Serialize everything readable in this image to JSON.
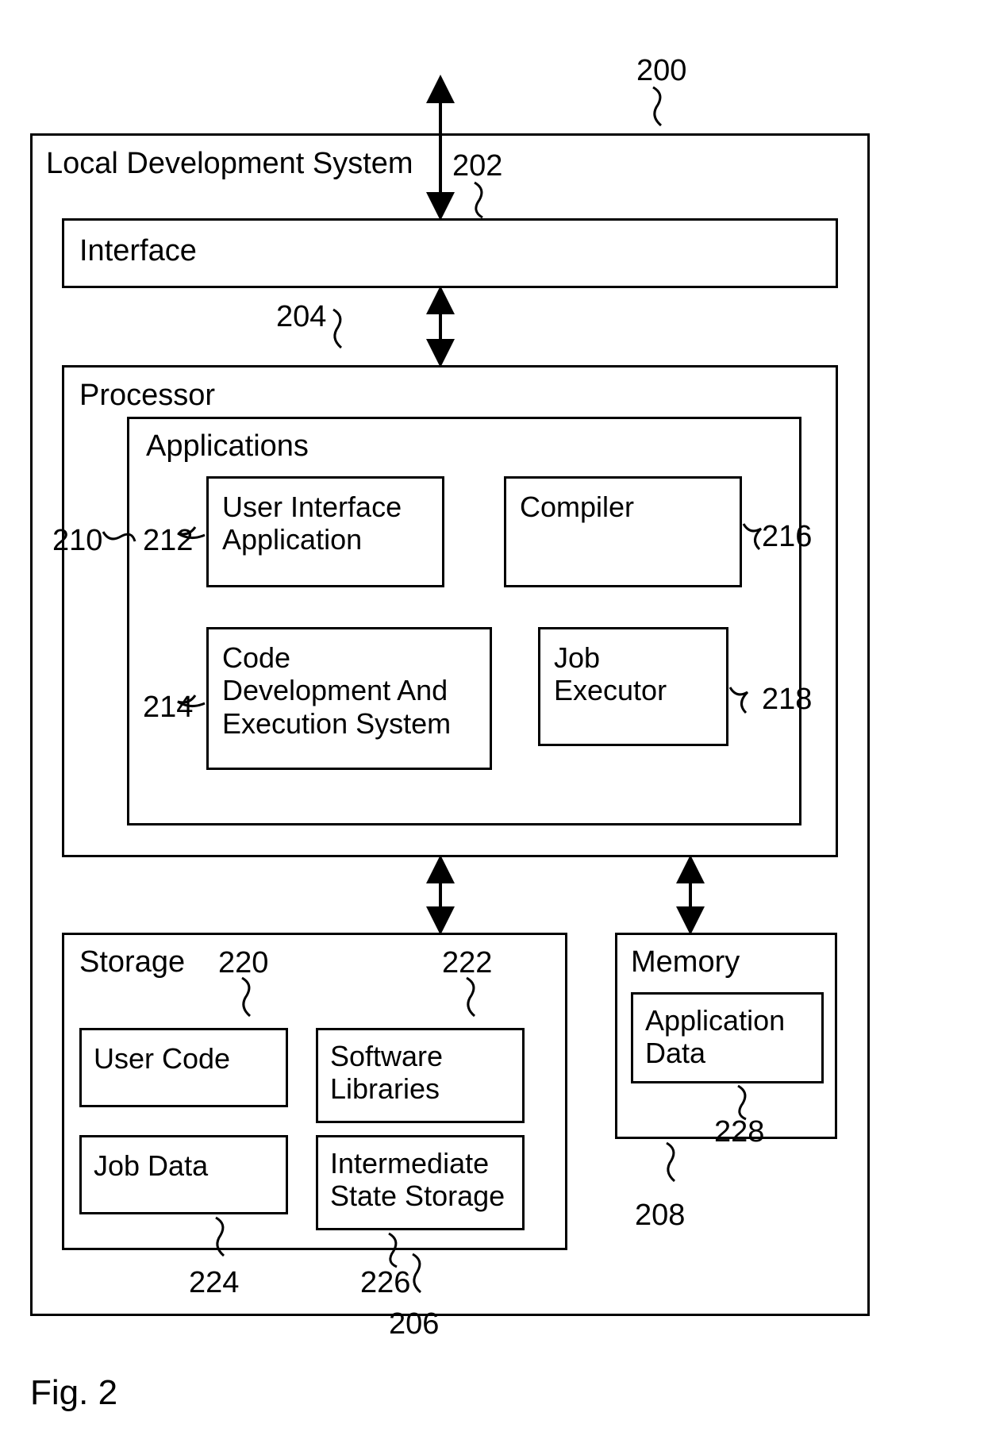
{
  "figure_label": "Fig. 2",
  "refs": {
    "r200": "200",
    "r202": "202",
    "r204": "204",
    "r206": "206",
    "r208": "208",
    "r210": "210",
    "r212": "212",
    "r214": "214",
    "r216": "216",
    "r218": "218",
    "r220": "220",
    "r222": "222",
    "r224": "224",
    "r226": "226",
    "r228": "228"
  },
  "blocks": {
    "system": "Local Development System",
    "interface": "Interface",
    "processor": "Processor",
    "applications": "Applications",
    "ui_app": "User Interface\nApplication",
    "compiler": "Compiler",
    "code_dev": "Code\nDevelopment And\nExecution System",
    "job_exec": "Job\nExecutor",
    "storage": "Storage",
    "user_code": "User Code",
    "sw_libs": "Software\nLibraries",
    "job_data": "Job Data",
    "inter_state": "Intermediate\nState Storage",
    "memory": "Memory",
    "app_data": "Application\nData"
  }
}
